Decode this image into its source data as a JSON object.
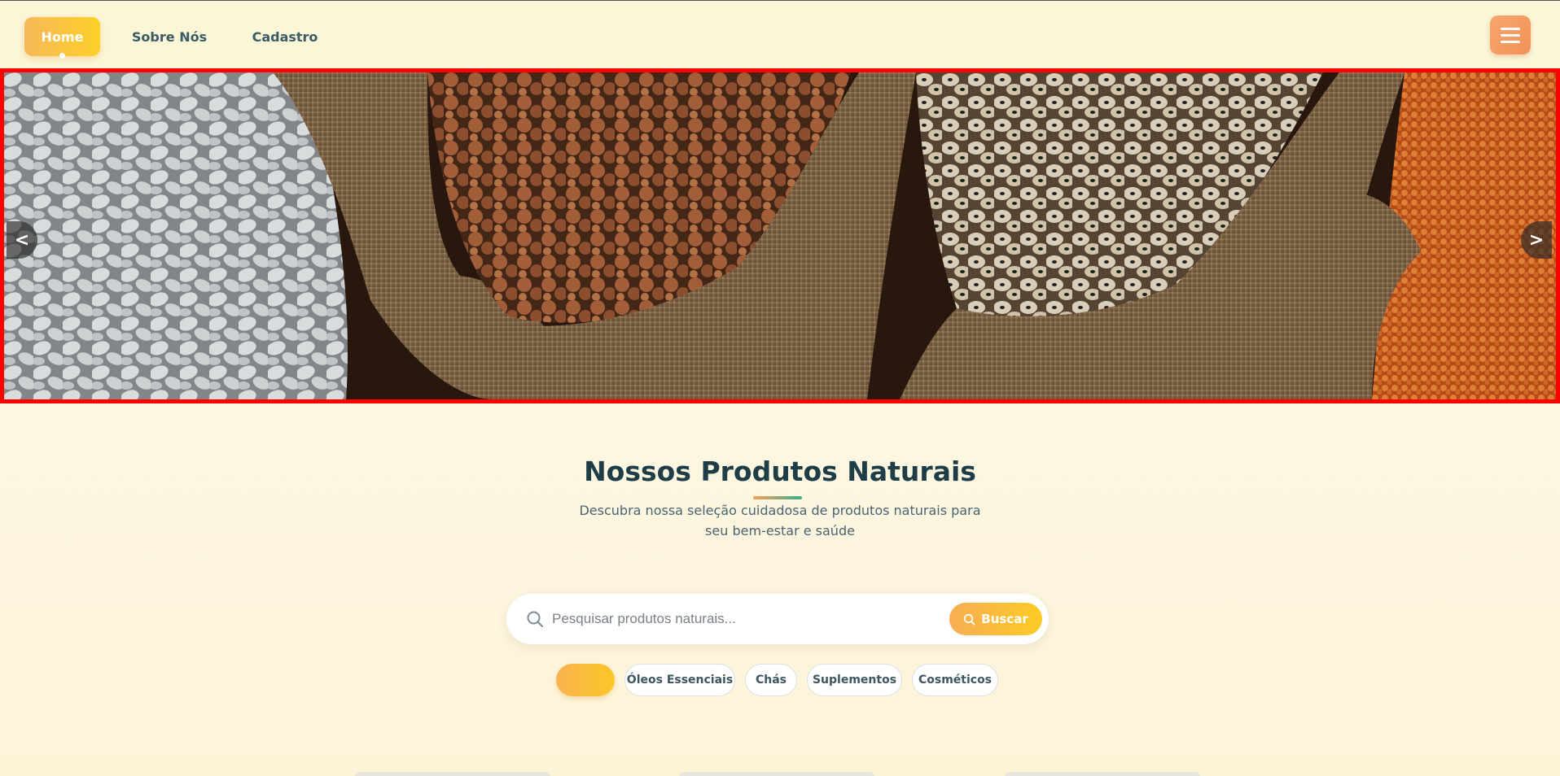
{
  "navbar": {
    "home_label": "Home",
    "about_label": "Sobre Nós",
    "register_label": "Cadastro",
    "menu_icon": "hamburger-menu-icon"
  },
  "carousel": {
    "prev_label": "<",
    "next_label": ">",
    "slide_description": "Sacks of white beans, chickpeas, black-eyed peas and red lentils"
  },
  "products": {
    "title": "Nossos Produtos Naturais",
    "subtitle": "Descubra nossa seleção cuidadosa de produtos naturais para seu bem-estar e saúde"
  },
  "search": {
    "placeholder": "Pesquisar produtos naturais...",
    "button_label": "Buscar",
    "icon": "search-icon"
  },
  "filters": {
    "active_label": "",
    "items": [
      "Óleos Essenciais",
      "Chás",
      "Suplementos",
      "Cosméticos"
    ]
  },
  "colors": {
    "accent_start": "#f8b85a",
    "accent_end": "#fdd027",
    "menu_button": "#f4a066",
    "heading": "#1e3d47",
    "carousel_border": "#ff0000"
  }
}
